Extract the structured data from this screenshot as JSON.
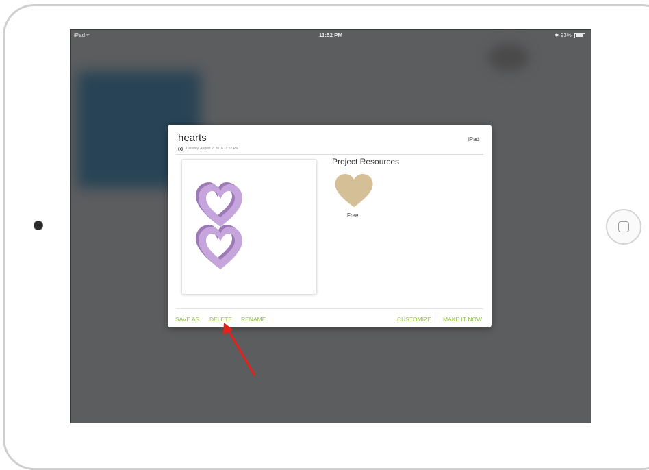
{
  "status_bar": {
    "device": "iPad",
    "wifi_icon": "wifi-icon",
    "time": "11:52 PM",
    "bluetooth_icon": "bluetooth-icon",
    "battery": "93%"
  },
  "dialog": {
    "title": "hearts",
    "device": "iPad",
    "date": "Tuesday, August 2, 2016 11:52 PM",
    "resources_title": "Project Resources",
    "resource": {
      "label": "Free",
      "color": "#d5bf96"
    },
    "preview_heart_color": "#c6a4dc",
    "buttons": {
      "save_as": "SAVE AS",
      "delete": "DELETE",
      "rename": "RENAME",
      "customize": "CUSTOMIZE",
      "make_it_now": "MAKE IT NOW"
    },
    "accent_color": "#8fc33c"
  },
  "annotation": {
    "color": "#e8201a"
  }
}
